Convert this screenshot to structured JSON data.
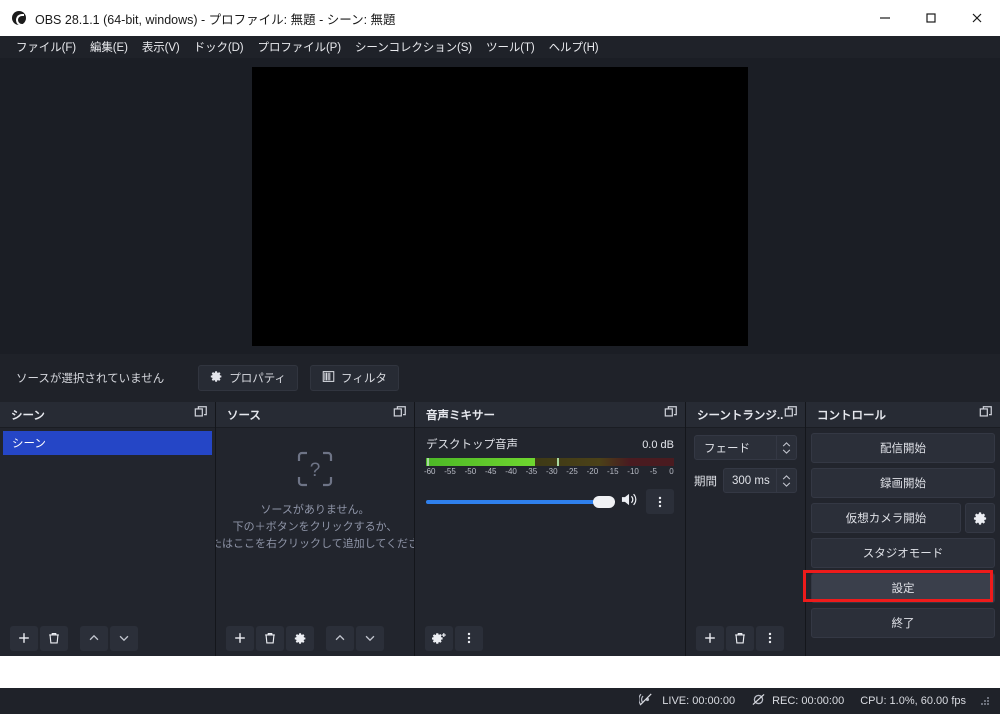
{
  "window": {
    "title": "OBS 28.1.1 (64-bit, windows) - プロファイル: 無題 - シーン: 無題",
    "app_icon": "obs-logo-icon",
    "buttons": {
      "minimize": "minimize-icon",
      "maximize": "maximize-icon",
      "close": "close-icon"
    }
  },
  "menubar": {
    "items": [
      {
        "label": "ファイル(F)"
      },
      {
        "label": "編集(E)"
      },
      {
        "label": "表示(V)"
      },
      {
        "label": "ドック(D)"
      },
      {
        "label": "プロファイル(P)"
      },
      {
        "label": "シーンコレクション(S)"
      },
      {
        "label": "ツール(T)"
      },
      {
        "label": "ヘルプ(H)"
      }
    ]
  },
  "source_toolbar": {
    "status_text": "ソースが選択されていません",
    "properties_label": "プロパティ",
    "filters_label": "フィルタ"
  },
  "scenes": {
    "title": "シーン",
    "items": [
      {
        "label": "シーン",
        "selected": true
      }
    ],
    "footer": [
      "add-icon",
      "remove-icon",
      "move-up-icon",
      "move-down-icon"
    ]
  },
  "sources": {
    "title": "ソース",
    "empty_lines": [
      "ソースがありません。",
      "下の＋ボタンをクリックするか、",
      "またはここを右クリックして追加してください"
    ],
    "footer": [
      "add-icon",
      "remove-icon",
      "properties-gear-icon",
      "move-up-icon",
      "move-down-icon"
    ]
  },
  "mixer": {
    "title": "音声ミキサー",
    "tracks": [
      {
        "name": "デスクトップ音声",
        "db": "0.0 dB",
        "level_percent": 44,
        "scale": [
          "-60",
          "-55",
          "-50",
          "-45",
          "-40",
          "-35",
          "-30",
          "-25",
          "-20",
          "-15",
          "-10",
          "-5",
          "0"
        ],
        "volume_percent": 100,
        "speaker_icon": "speaker-icon",
        "menu_icon": "vertical-dots-icon"
      }
    ],
    "footer": [
      "advanced-audio-properties-icon",
      "vertical-dots-icon"
    ]
  },
  "transitions": {
    "title": "シーントランジ...",
    "transition_value": "フェード",
    "duration_label": "期間",
    "duration_value": "300 ms",
    "footer": [
      "add-icon",
      "remove-icon",
      "vertical-dots-icon"
    ]
  },
  "controls": {
    "title": "コントロール",
    "buttons": [
      {
        "label": "配信開始",
        "name": "start-streaming-button"
      },
      {
        "label": "録画開始",
        "name": "start-recording-button"
      },
      {
        "label": "仮想カメラ開始",
        "name": "start-virtual-camera-button"
      },
      {
        "label": "スタジオモード",
        "name": "studio-mode-button"
      },
      {
        "label": "設定",
        "name": "settings-button",
        "highlighted": true
      },
      {
        "label": "終了",
        "name": "exit-button"
      }
    ],
    "virtual_camera_gear": "gear-icon"
  },
  "statusbar": {
    "live_label": "LIVE: 00:00:00",
    "rec_label": "REC: 00:00:00",
    "cpu_label": "CPU: 1.0%, 60.00 fps",
    "live_icon": "broadcast-off-icon",
    "rec_icon": "record-off-icon"
  },
  "colors": {
    "accent_selected": "#2546c6",
    "highlight_box": "#ee1b1b",
    "panel_bg": "#22252d",
    "header_bg": "#272b34",
    "slider": "#2f80ed"
  }
}
